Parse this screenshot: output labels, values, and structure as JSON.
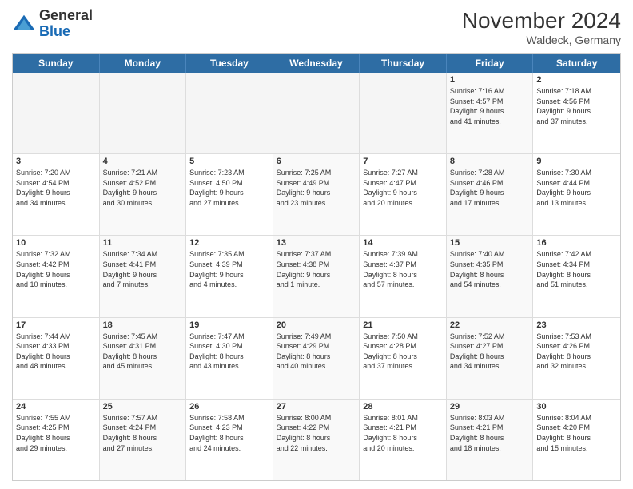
{
  "header": {
    "logo_general": "General",
    "logo_blue": "Blue",
    "month_title": "November 2024",
    "subtitle": "Waldeck, Germany"
  },
  "days_of_week": [
    "Sunday",
    "Monday",
    "Tuesday",
    "Wednesday",
    "Thursday",
    "Friday",
    "Saturday"
  ],
  "rows": [
    {
      "cells": [
        {
          "day": "",
          "text": "",
          "empty": true
        },
        {
          "day": "",
          "text": "",
          "empty": true
        },
        {
          "day": "",
          "text": "",
          "empty": true
        },
        {
          "day": "",
          "text": "",
          "empty": true
        },
        {
          "day": "",
          "text": "",
          "empty": true
        },
        {
          "day": "1",
          "text": "Sunrise: 7:16 AM\nSunset: 4:57 PM\nDaylight: 9 hours\nand 41 minutes.",
          "empty": false
        },
        {
          "day": "2",
          "text": "Sunrise: 7:18 AM\nSunset: 4:56 PM\nDaylight: 9 hours\nand 37 minutes.",
          "empty": false
        }
      ]
    },
    {
      "cells": [
        {
          "day": "3",
          "text": "Sunrise: 7:20 AM\nSunset: 4:54 PM\nDaylight: 9 hours\nand 34 minutes.",
          "empty": false
        },
        {
          "day": "4",
          "text": "Sunrise: 7:21 AM\nSunset: 4:52 PM\nDaylight: 9 hours\nand 30 minutes.",
          "empty": false
        },
        {
          "day": "5",
          "text": "Sunrise: 7:23 AM\nSunset: 4:50 PM\nDaylight: 9 hours\nand 27 minutes.",
          "empty": false
        },
        {
          "day": "6",
          "text": "Sunrise: 7:25 AM\nSunset: 4:49 PM\nDaylight: 9 hours\nand 23 minutes.",
          "empty": false
        },
        {
          "day": "7",
          "text": "Sunrise: 7:27 AM\nSunset: 4:47 PM\nDaylight: 9 hours\nand 20 minutes.",
          "empty": false
        },
        {
          "day": "8",
          "text": "Sunrise: 7:28 AM\nSunset: 4:46 PM\nDaylight: 9 hours\nand 17 minutes.",
          "empty": false
        },
        {
          "day": "9",
          "text": "Sunrise: 7:30 AM\nSunset: 4:44 PM\nDaylight: 9 hours\nand 13 minutes.",
          "empty": false
        }
      ]
    },
    {
      "cells": [
        {
          "day": "10",
          "text": "Sunrise: 7:32 AM\nSunset: 4:42 PM\nDaylight: 9 hours\nand 10 minutes.",
          "empty": false
        },
        {
          "day": "11",
          "text": "Sunrise: 7:34 AM\nSunset: 4:41 PM\nDaylight: 9 hours\nand 7 minutes.",
          "empty": false
        },
        {
          "day": "12",
          "text": "Sunrise: 7:35 AM\nSunset: 4:39 PM\nDaylight: 9 hours\nand 4 minutes.",
          "empty": false
        },
        {
          "day": "13",
          "text": "Sunrise: 7:37 AM\nSunset: 4:38 PM\nDaylight: 9 hours\nand 1 minute.",
          "empty": false
        },
        {
          "day": "14",
          "text": "Sunrise: 7:39 AM\nSunset: 4:37 PM\nDaylight: 8 hours\nand 57 minutes.",
          "empty": false
        },
        {
          "day": "15",
          "text": "Sunrise: 7:40 AM\nSunset: 4:35 PM\nDaylight: 8 hours\nand 54 minutes.",
          "empty": false
        },
        {
          "day": "16",
          "text": "Sunrise: 7:42 AM\nSunset: 4:34 PM\nDaylight: 8 hours\nand 51 minutes.",
          "empty": false
        }
      ]
    },
    {
      "cells": [
        {
          "day": "17",
          "text": "Sunrise: 7:44 AM\nSunset: 4:33 PM\nDaylight: 8 hours\nand 48 minutes.",
          "empty": false
        },
        {
          "day": "18",
          "text": "Sunrise: 7:45 AM\nSunset: 4:31 PM\nDaylight: 8 hours\nand 45 minutes.",
          "empty": false
        },
        {
          "day": "19",
          "text": "Sunrise: 7:47 AM\nSunset: 4:30 PM\nDaylight: 8 hours\nand 43 minutes.",
          "empty": false
        },
        {
          "day": "20",
          "text": "Sunrise: 7:49 AM\nSunset: 4:29 PM\nDaylight: 8 hours\nand 40 minutes.",
          "empty": false
        },
        {
          "day": "21",
          "text": "Sunrise: 7:50 AM\nSunset: 4:28 PM\nDaylight: 8 hours\nand 37 minutes.",
          "empty": false
        },
        {
          "day": "22",
          "text": "Sunrise: 7:52 AM\nSunset: 4:27 PM\nDaylight: 8 hours\nand 34 minutes.",
          "empty": false
        },
        {
          "day": "23",
          "text": "Sunrise: 7:53 AM\nSunset: 4:26 PM\nDaylight: 8 hours\nand 32 minutes.",
          "empty": false
        }
      ]
    },
    {
      "cells": [
        {
          "day": "24",
          "text": "Sunrise: 7:55 AM\nSunset: 4:25 PM\nDaylight: 8 hours\nand 29 minutes.",
          "empty": false
        },
        {
          "day": "25",
          "text": "Sunrise: 7:57 AM\nSunset: 4:24 PM\nDaylight: 8 hours\nand 27 minutes.",
          "empty": false
        },
        {
          "day": "26",
          "text": "Sunrise: 7:58 AM\nSunset: 4:23 PM\nDaylight: 8 hours\nand 24 minutes.",
          "empty": false
        },
        {
          "day": "27",
          "text": "Sunrise: 8:00 AM\nSunset: 4:22 PM\nDaylight: 8 hours\nand 22 minutes.",
          "empty": false
        },
        {
          "day": "28",
          "text": "Sunrise: 8:01 AM\nSunset: 4:21 PM\nDaylight: 8 hours\nand 20 minutes.",
          "empty": false
        },
        {
          "day": "29",
          "text": "Sunrise: 8:03 AM\nSunset: 4:21 PM\nDaylight: 8 hours\nand 18 minutes.",
          "empty": false
        },
        {
          "day": "30",
          "text": "Sunrise: 8:04 AM\nSunset: 4:20 PM\nDaylight: 8 hours\nand 15 minutes.",
          "empty": false
        }
      ]
    }
  ]
}
